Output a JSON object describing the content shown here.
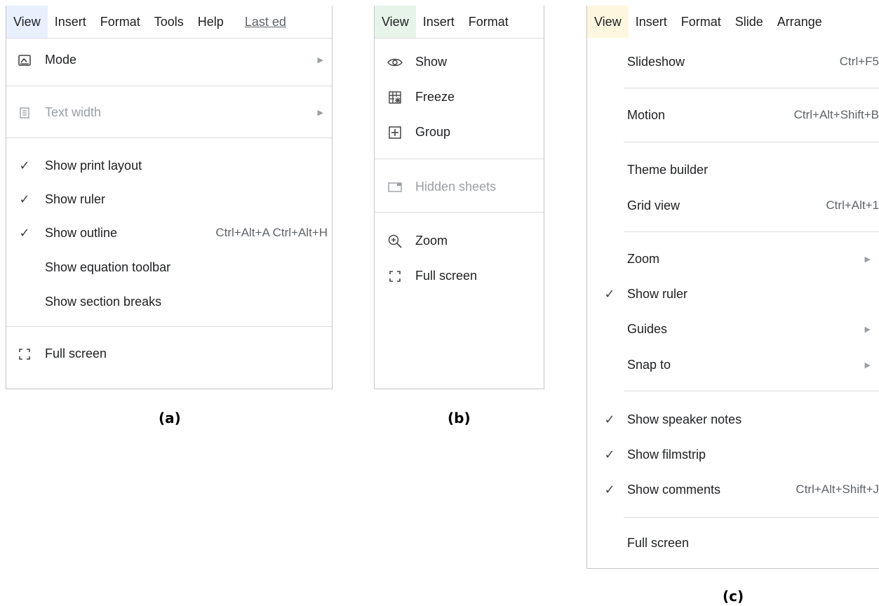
{
  "panel_a": {
    "menubar": [
      "View",
      "Insert",
      "Format",
      "Tools",
      "Help",
      "Last ed"
    ],
    "items": [
      {
        "label": "Mode",
        "icon": "mode-icon",
        "submenu": true
      },
      {
        "label": "Text width",
        "icon": "text-width-icon",
        "submenu": true,
        "disabled": true
      },
      {
        "label": "Show print layout",
        "checked": true
      },
      {
        "label": "Show ruler",
        "checked": true
      },
      {
        "label": "Show outline",
        "checked": true,
        "shortcut": "Ctrl+Alt+A Ctrl+Alt+H"
      },
      {
        "label": "Show equation toolbar"
      },
      {
        "label": "Show section breaks"
      },
      {
        "label": "Full screen",
        "icon": "fullscreen-icon"
      }
    ],
    "caption": "(a)"
  },
  "panel_b": {
    "menubar": [
      "View",
      "Insert",
      "Format"
    ],
    "items": [
      {
        "label": "Show",
        "icon": "eye-icon"
      },
      {
        "label": "Freeze",
        "icon": "freeze-icon"
      },
      {
        "label": "Group",
        "icon": "group-icon"
      },
      {
        "label": "Hidden sheets",
        "icon": "hidden-sheets-icon",
        "disabled": true
      },
      {
        "label": "Zoom",
        "icon": "zoom-icon"
      },
      {
        "label": "Full screen",
        "icon": "fullscreen-icon"
      }
    ],
    "caption": "(b)"
  },
  "panel_c": {
    "menubar": [
      "View",
      "Insert",
      "Format",
      "Slide",
      "Arrange"
    ],
    "items": [
      {
        "label": "Slideshow",
        "shortcut": "Ctrl+F5"
      },
      {
        "label": "Motion",
        "shortcut": "Ctrl+Alt+Shift+B"
      },
      {
        "label": "Theme builder"
      },
      {
        "label": "Grid view",
        "shortcut": "Ctrl+Alt+1"
      },
      {
        "label": "Zoom",
        "submenu": true
      },
      {
        "label": "Show ruler",
        "checked": true
      },
      {
        "label": "Guides",
        "submenu": true
      },
      {
        "label": "Snap to",
        "submenu": true
      },
      {
        "label": "Show speaker notes",
        "checked": true
      },
      {
        "label": "Show filmstrip",
        "checked": true
      },
      {
        "label": "Show comments",
        "checked": true,
        "shortcut": "Ctrl+Alt+Shift+J"
      },
      {
        "label": "Full screen"
      }
    ],
    "caption": "(c)"
  },
  "colors": {
    "docs_active": "#e8f0fe",
    "sheets_active": "#e6f4ea",
    "slides_active": "#fef7e0",
    "disabled_text": "#9aa0a6",
    "separator": "#dadce0"
  }
}
